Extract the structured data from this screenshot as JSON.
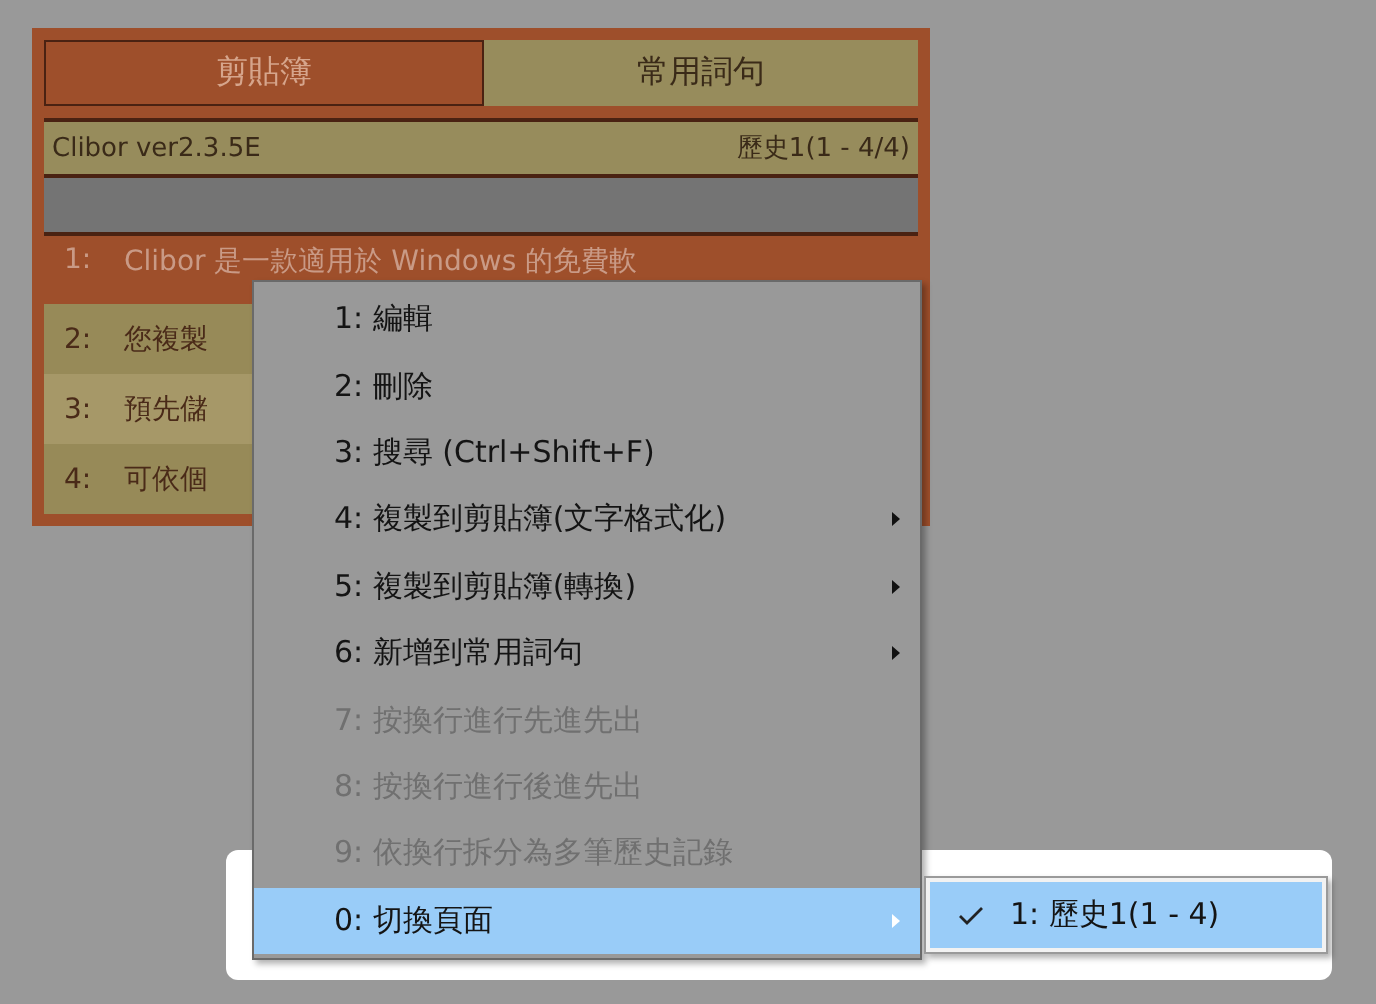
{
  "clipboard_window": {
    "tabs": [
      {
        "label": "剪貼簿",
        "selected": true
      },
      {
        "label": "常用詞句",
        "selected": false
      }
    ],
    "version": "Clibor ver2.3.5E",
    "history_status": "歷史1(1 - 4/4)",
    "rows": [
      {
        "number": "1:",
        "text": "Clibor 是一款適用於 Windows 的免費軟",
        "selected": true
      },
      {
        "number": "2:",
        "text": "您複製",
        "selected": false
      },
      {
        "number": "3:",
        "text": "預先儲",
        "selected": false
      },
      {
        "number": "4:",
        "text": "可依個",
        "selected": false
      }
    ]
  },
  "context_menu": {
    "items": [
      {
        "label": "1: 編輯",
        "disabled": false,
        "submenu": false,
        "selected": false
      },
      {
        "label": "2: 刪除",
        "disabled": false,
        "submenu": false,
        "selected": false
      },
      {
        "label": "3: 搜尋 (Ctrl+Shift+F)",
        "disabled": false,
        "submenu": false,
        "selected": false
      },
      {
        "label": "4: 複製到剪貼簿(文字格式化)",
        "disabled": false,
        "submenu": true,
        "selected": false
      },
      {
        "label": "5: 複製到剪貼簿(轉換)",
        "disabled": false,
        "submenu": true,
        "selected": false
      },
      {
        "label": "6: 新增到常用詞句",
        "disabled": false,
        "submenu": true,
        "selected": false
      },
      {
        "label": "7: 按換行進行先進先出",
        "disabled": true,
        "submenu": false,
        "selected": false
      },
      {
        "label": "8: 按換行進行後進先出",
        "disabled": true,
        "submenu": false,
        "selected": false
      },
      {
        "label": "9: 依換行拆分為多筆歷史記錄",
        "disabled": true,
        "submenu": false,
        "selected": false
      },
      {
        "label": "0: 切換頁面",
        "disabled": false,
        "submenu": true,
        "selected": true
      }
    ]
  },
  "submenu": {
    "items": [
      {
        "label": "1: 歷史1(1 - 4)",
        "checked": true,
        "selected": true
      }
    ]
  }
}
